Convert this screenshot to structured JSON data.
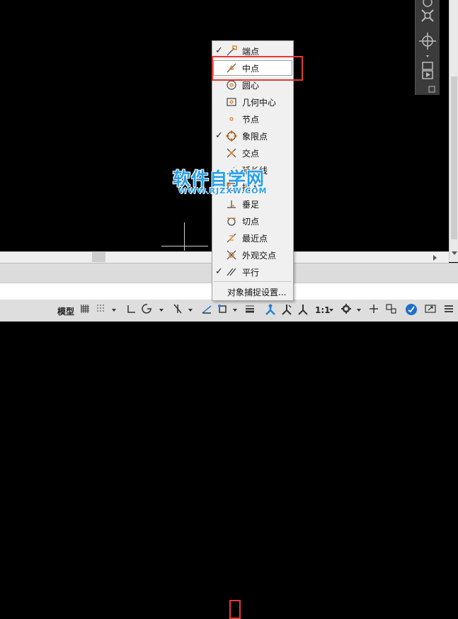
{
  "osnap_menu": {
    "items": [
      {
        "label": "端点",
        "checked": true,
        "icon": "endpoint-icon"
      },
      {
        "label": "中点",
        "checked": false,
        "icon": "midpoint-icon",
        "highlighted": true
      },
      {
        "label": "圆心",
        "checked": false,
        "icon": "center-icon"
      },
      {
        "label": "几何中心",
        "checked": false,
        "icon": "geometric-center-icon"
      },
      {
        "label": "节点",
        "checked": false,
        "icon": "node-icon"
      },
      {
        "label": "象限点",
        "checked": true,
        "icon": "quadrant-icon"
      },
      {
        "label": "交点",
        "checked": false,
        "icon": "intersection-icon"
      },
      {
        "label": "延长线",
        "checked": false,
        "icon": "extension-icon"
      },
      {
        "label": "插入",
        "checked": false,
        "icon": "insertion-icon"
      },
      {
        "label": "垂足",
        "checked": false,
        "icon": "perpendicular-icon"
      },
      {
        "label": "切点",
        "checked": false,
        "icon": "tangent-icon"
      },
      {
        "label": "最近点",
        "checked": false,
        "icon": "nearest-icon"
      },
      {
        "label": "外观交点",
        "checked": false,
        "icon": "apparent-intersection-icon"
      },
      {
        "label": "平行",
        "checked": true,
        "icon": "parallel-icon"
      }
    ],
    "settings_label": "对象捕捉设置...",
    "check_mark": "✓"
  },
  "statusbar": {
    "model_label": "模型",
    "scale_label": "1:1"
  },
  "watermark": {
    "main": "软件自学网",
    "sub": "WWW.RJZXW.COM"
  },
  "colors": {
    "highlight_red": "#e53935",
    "watermark_blue": "#2aa0e8",
    "canvas": "#000000"
  }
}
